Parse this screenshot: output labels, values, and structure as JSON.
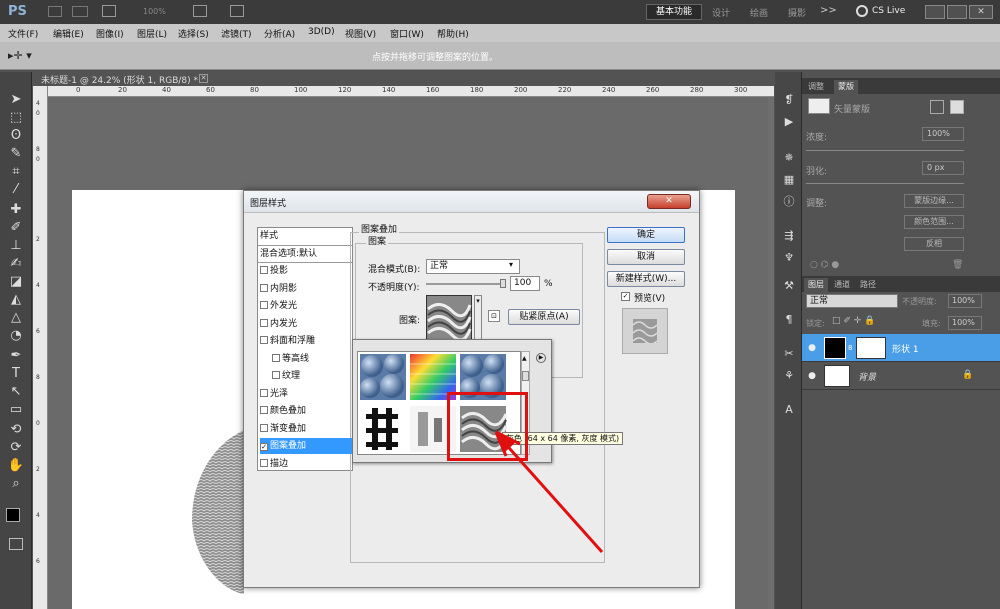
{
  "app": {
    "logo": "PS",
    "zoom": "100%",
    "workspace": "基本功能",
    "ws_items": [
      "设计",
      "绘画",
      "摄影",
      ">>"
    ],
    "cslive": "CS Live"
  },
  "menu": [
    "文件(F)",
    "编辑(E)",
    "图像(I)",
    "图层(L)",
    "选择(S)",
    "滤镜(T)",
    "分析(A)",
    "3D(D)",
    "视图(V)",
    "窗口(W)",
    "帮助(H)"
  ],
  "options": {
    "hint": "点按并拖移可调整图案的位置。"
  },
  "document": {
    "tab": "未标题-1 @ 24.2% (形状 1, RGB/8) *",
    "ruler_h": [
      "0",
      "20",
      "40",
      "60",
      "80",
      "100",
      "120",
      "140",
      "160",
      "180",
      "200",
      "220",
      "240",
      "260",
      "280",
      "300"
    ],
    "ruler_v": [
      "4",
      "0",
      "8",
      "0",
      "2",
      "4",
      "6",
      "8",
      "0",
      "2",
      "4",
      "6",
      "8",
      "0",
      "2",
      "4",
      "6"
    ]
  },
  "dialog": {
    "title": "图层样式",
    "styles_header": "样式",
    "blend_default": "混合选项:默认",
    "styles": [
      {
        "label": "投影",
        "checked": false,
        "indent": false
      },
      {
        "label": "内阴影",
        "checked": false,
        "indent": false
      },
      {
        "label": "外发光",
        "checked": false,
        "indent": false
      },
      {
        "label": "内发光",
        "checked": false,
        "indent": false
      },
      {
        "label": "斜面和浮雕",
        "checked": false,
        "indent": false
      },
      {
        "label": "等高线",
        "checked": false,
        "indent": true
      },
      {
        "label": "纹理",
        "checked": false,
        "indent": true
      },
      {
        "label": "光泽",
        "checked": false,
        "indent": false
      },
      {
        "label": "颜色叠加",
        "checked": false,
        "indent": false
      },
      {
        "label": "渐变叠加",
        "checked": false,
        "indent": false
      },
      {
        "label": "图案叠加",
        "checked": true,
        "indent": false
      },
      {
        "label": "描边",
        "checked": false,
        "indent": false
      }
    ],
    "group_title": "图案叠加",
    "sub_title": "图案",
    "blend_label": "混合模式(B):",
    "blend_value": "正常",
    "opacity_label": "不透明度(Y):",
    "opacity_value": "100",
    "percent": "%",
    "pattern_label": "图案:",
    "snap_button": "贴紧原点(A)",
    "ok": "确定",
    "cancel": "取消",
    "new_style": "新建样式(W)...",
    "preview": "预览(V)",
    "tooltip": "灰色 (64 x 64 像素, 灰度 模式)"
  },
  "right_panel": {
    "adj_tabs": [
      "调整",
      "蒙版"
    ],
    "mask_type": "矢量蒙版",
    "density_label": "浓度:",
    "density_value": "100%",
    "feather_label": "羽化:",
    "feather_value": "0 px",
    "refine_label": "调整:",
    "mask_edge": "蒙版边缘...",
    "color_range": "颜色范围...",
    "invert": "反相",
    "layer_tabs": [
      "图层",
      "通道",
      "路径"
    ],
    "blend_mode": "正常",
    "opacity_label": "不透明度:",
    "opacity_value": "100%",
    "lock_label": "锁定:",
    "fill_label": "填充:",
    "fill_value": "100%",
    "layers": [
      {
        "name": "形状 1",
        "selected": true
      },
      {
        "name": "背景",
        "selected": false
      }
    ]
  }
}
